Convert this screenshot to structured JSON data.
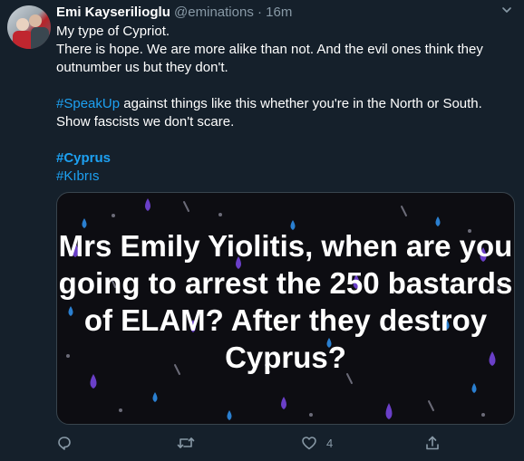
{
  "author": {
    "name": "Emi Kayserilioglu",
    "handle": "@eminations",
    "separator": "·",
    "time": "16m"
  },
  "tweet": {
    "line1": "My type of Cypriot.",
    "line2": "There is hope. We are more alike than not. And the evil ones think they outnumber us but they don't.",
    "hashtag_speakup": "#SpeakUp",
    "line3_rest": " against things like this whether you're in the North or South. Show fascists we don't scare.",
    "hashtag_cyprus": "#Cyprus",
    "hashtag_kibris": "#Kıbrıs"
  },
  "media": {
    "headline": "Mrs Emily Yiolitis, when are you going to arrest the 250 bastards of ELAM? After they destroy Cyprus?"
  },
  "actions": {
    "like_count": "4"
  },
  "colors": {
    "background": "#15202b",
    "link": "#1da1f2",
    "muted": "#8899a6"
  },
  "icons": [
    "caret-down-icon",
    "reply-icon",
    "retweet-icon",
    "like-icon",
    "share-icon"
  ]
}
